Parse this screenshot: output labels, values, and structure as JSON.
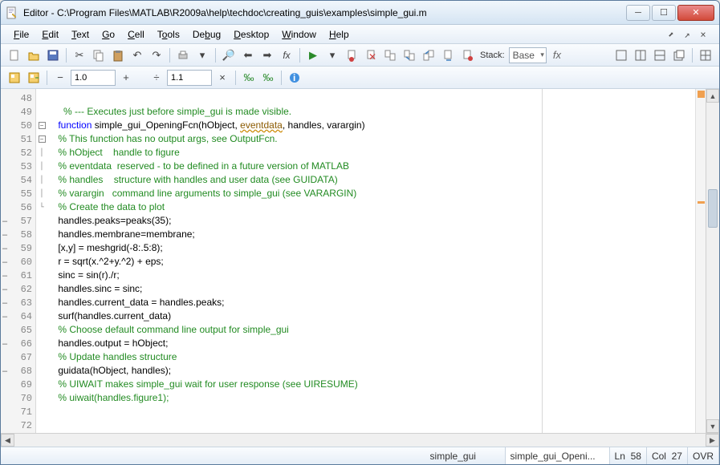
{
  "window": {
    "title": "Editor - C:\\Program Files\\MATLAB\\R2009a\\help\\techdoc\\creating_guis\\examples\\simple_gui.m"
  },
  "menus": [
    "File",
    "Edit",
    "Text",
    "Go",
    "Cell",
    "Tools",
    "Debug",
    "Desktop",
    "Window",
    "Help"
  ],
  "menu_accel": [
    "F",
    "E",
    "T",
    "G",
    "C",
    "o",
    "b",
    "D",
    "W",
    "H"
  ],
  "toolbar2": {
    "val1": "1.0",
    "val2": "1.1"
  },
  "stack": {
    "label": "Stack:",
    "value": "Base"
  },
  "fx_label": "fx",
  "lines": [
    {
      "n": 48,
      "mark": "",
      "fold": "",
      "seg": [
        {
          "t": "",
          "c": ""
        }
      ]
    },
    {
      "n": 49,
      "mark": "",
      "fold": "",
      "seg": [
        {
          "t": "      ",
          "c": ""
        },
        {
          "t": "% --- Executes just before simple_gui is made visible.",
          "c": "c-comment"
        }
      ]
    },
    {
      "n": 50,
      "mark": "",
      "fold": "box-",
      "seg": [
        {
          "t": "    ",
          "c": ""
        },
        {
          "t": "function",
          "c": "c-keyword"
        },
        {
          "t": " simple_gui_OpeningFcn(hObject, ",
          "c": ""
        },
        {
          "t": "eventdata",
          "c": "c-warn"
        },
        {
          "t": ", handles, varargin)",
          "c": ""
        }
      ]
    },
    {
      "n": 51,
      "mark": "",
      "fold": "box-",
      "seg": [
        {
          "t": "    ",
          "c": ""
        },
        {
          "t": "% This function has no output args, see OutputFcn.",
          "c": "c-comment"
        }
      ]
    },
    {
      "n": 52,
      "mark": "",
      "fold": "pipe",
      "seg": [
        {
          "t": "    ",
          "c": ""
        },
        {
          "t": "% hObject    handle to figure",
          "c": "c-comment"
        }
      ]
    },
    {
      "n": 53,
      "mark": "",
      "fold": "pipe",
      "seg": [
        {
          "t": "    ",
          "c": ""
        },
        {
          "t": "% eventdata  reserved - to be defined in a future version of MATLAB",
          "c": "c-comment"
        }
      ]
    },
    {
      "n": 54,
      "mark": "",
      "fold": "pipe",
      "seg": [
        {
          "t": "    ",
          "c": ""
        },
        {
          "t": "% handles    structure with handles and user data (see GUIDATA)",
          "c": "c-comment"
        }
      ]
    },
    {
      "n": 55,
      "mark": "",
      "fold": "pipe",
      "seg": [
        {
          "t": "    ",
          "c": ""
        },
        {
          "t": "% varargin   command line arguments to simple_gui (see VARARGIN)",
          "c": "c-comment"
        }
      ]
    },
    {
      "n": 56,
      "mark": "",
      "fold": "end",
      "seg": [
        {
          "t": "    ",
          "c": ""
        },
        {
          "t": "% Create the data to plot",
          "c": "c-comment"
        }
      ]
    },
    {
      "n": 57,
      "mark": "–",
      "fold": "",
      "seg": [
        {
          "t": "    handles.peaks=peaks(35);",
          "c": ""
        }
      ]
    },
    {
      "n": 58,
      "mark": "–",
      "fold": "",
      "seg": [
        {
          "t": "    handles.membrane=membrane;",
          "c": ""
        }
      ]
    },
    {
      "n": 59,
      "mark": "–",
      "fold": "",
      "seg": [
        {
          "t": "    [x,y] = meshgrid(-8:.5:8);",
          "c": ""
        }
      ]
    },
    {
      "n": 60,
      "mark": "–",
      "fold": "",
      "seg": [
        {
          "t": "    r = sqrt(x.^2+y.^2) + eps;",
          "c": ""
        }
      ]
    },
    {
      "n": 61,
      "mark": "–",
      "fold": "",
      "seg": [
        {
          "t": "    sinc = sin(r)./r;",
          "c": ""
        }
      ]
    },
    {
      "n": 62,
      "mark": "–",
      "fold": "",
      "seg": [
        {
          "t": "    handles.sinc = sinc;",
          "c": ""
        }
      ]
    },
    {
      "n": 63,
      "mark": "–",
      "fold": "",
      "seg": [
        {
          "t": "    handles.current_data = handles.peaks;",
          "c": ""
        }
      ]
    },
    {
      "n": 64,
      "mark": "–",
      "fold": "",
      "seg": [
        {
          "t": "    surf(handles.current_data)",
          "c": ""
        }
      ]
    },
    {
      "n": 65,
      "mark": "",
      "fold": "",
      "seg": [
        {
          "t": "    ",
          "c": ""
        },
        {
          "t": "% Choose default command line output for simple_gui",
          "c": "c-comment"
        }
      ]
    },
    {
      "n": 66,
      "mark": "–",
      "fold": "",
      "seg": [
        {
          "t": "    handles.output = hObject;",
          "c": ""
        }
      ]
    },
    {
      "n": 67,
      "mark": "",
      "fold": "",
      "seg": [
        {
          "t": "    ",
          "c": ""
        },
        {
          "t": "% Update handles structure",
          "c": "c-comment"
        }
      ]
    },
    {
      "n": 68,
      "mark": "–",
      "fold": "",
      "seg": [
        {
          "t": "    guidata(hObject, handles);",
          "c": ""
        }
      ]
    },
    {
      "n": 69,
      "mark": "",
      "fold": "",
      "seg": [
        {
          "t": "    ",
          "c": ""
        },
        {
          "t": "% UIWAIT makes simple_gui wait for user response (see UIRESUME)",
          "c": "c-comment"
        }
      ]
    },
    {
      "n": 70,
      "mark": "",
      "fold": "",
      "seg": [
        {
          "t": "    ",
          "c": ""
        },
        {
          "t": "% uiwait(handles.figure1);",
          "c": "c-comment"
        }
      ]
    },
    {
      "n": 71,
      "mark": "",
      "fold": "",
      "seg": [
        {
          "t": "",
          "c": ""
        }
      ]
    },
    {
      "n": 72,
      "mark": "",
      "fold": "",
      "seg": [
        {
          "t": "",
          "c": ""
        }
      ]
    }
  ],
  "status": {
    "tab1": "simple_gui",
    "tab2": "simple_gui_Openi...",
    "ln_label": "Ln",
    "ln": "58",
    "col_label": "Col",
    "col": "27",
    "mode": "OVR"
  }
}
